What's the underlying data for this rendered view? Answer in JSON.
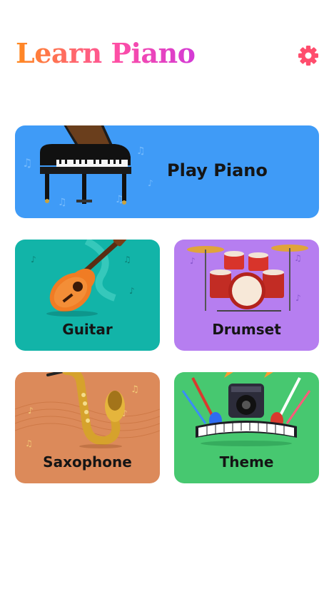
{
  "header": {
    "title": "Learn Piano",
    "settings_icon": "gear-icon"
  },
  "cards": {
    "piano": {
      "label": "Play Piano",
      "icon": "grand-piano-icon"
    },
    "guitar": {
      "label": "Guitar",
      "icon": "guitar-icon"
    },
    "drumset": {
      "label": "Drumset",
      "icon": "drumset-icon"
    },
    "saxophone": {
      "label": "Saxophone",
      "icon": "saxophone-icon"
    },
    "theme": {
      "label": "Theme",
      "icon": "theme-instruments-icon"
    }
  },
  "colors": {
    "piano_card": "#3f9bf7",
    "guitar_card": "#12b4a8",
    "drum_card": "#b67ef0",
    "sax_card": "#dc8a5a",
    "theme_card": "#47c870",
    "settings_icon": "#ff4d6d"
  }
}
